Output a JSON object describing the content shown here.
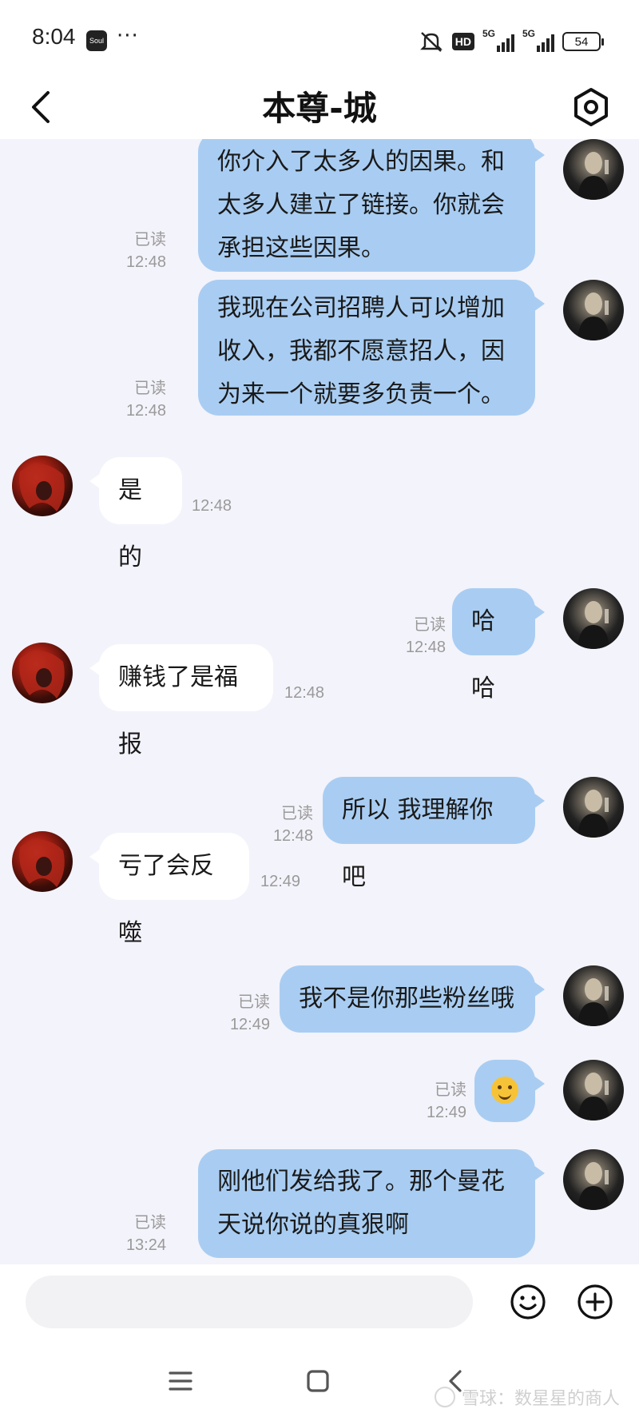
{
  "status_bar": {
    "time": "8:04",
    "app_badge": "Soul",
    "more": "···",
    "hd": "HD",
    "sim1": "5G",
    "sim2": "5G",
    "battery": "54"
  },
  "header": {
    "title": "本尊-城"
  },
  "messages": [
    {
      "sender": "me",
      "lines": [
        "你介入了太多人的因果。和",
        "太多人建立了链接。你就会",
        "承担这些因果。"
      ],
      "read": "已读",
      "time": "12:48"
    },
    {
      "sender": "me",
      "lines": [
        "我现在公司招聘人可以增加",
        "收入，我都不愿意招人，因",
        "为来一个就要多负责一个。"
      ],
      "read": "已读",
      "time": "12:48"
    },
    {
      "sender": "other",
      "lines": [
        "是的"
      ],
      "time": "12:48"
    },
    {
      "sender": "me",
      "lines": [
        "哈哈"
      ],
      "read": "已读",
      "time": "12:48"
    },
    {
      "sender": "other",
      "lines": [
        "赚钱了是福报"
      ],
      "time": "12:48"
    },
    {
      "sender": "me",
      "lines": [
        "所以 我理解你吧"
      ],
      "read": "已读",
      "time": "12:48"
    },
    {
      "sender": "other",
      "lines": [
        "亏了会反噬"
      ],
      "time": "12:49"
    },
    {
      "sender": "me",
      "lines": [
        "我不是你那些粉丝哦"
      ],
      "read": "已读",
      "time": "12:49"
    },
    {
      "sender": "me",
      "emoji": "smile",
      "read": "已读",
      "time": "12:49"
    },
    {
      "sender": "me",
      "lines": [
        "刚他们发给我了。那个曼花",
        "天说你说的真狠啊"
      ],
      "read": "已读",
      "time": "13:24"
    }
  ],
  "input": {
    "value": "",
    "placeholder": ""
  },
  "icons": {
    "back": "back-arrow-icon",
    "settings": "settings-gear-icon",
    "emoji": "emoji-icon",
    "plus": "plus-icon",
    "menu": "menu-icon",
    "home": "home-icon",
    "nav_back": "nav-back-icon"
  },
  "colors": {
    "my_bubble": "#a9cdf2",
    "other_bubble": "#ffffff",
    "background": "#f3f3fb"
  },
  "watermark": {
    "text": "雪球：数星星的商人"
  }
}
